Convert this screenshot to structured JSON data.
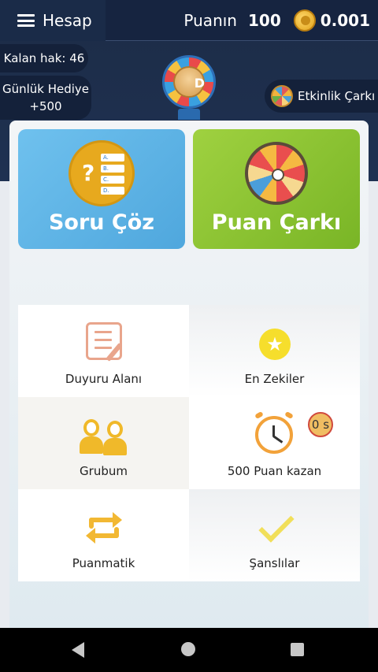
{
  "topbar": {
    "menu_label": "Hesap",
    "score_label": "Puanın",
    "score_value": "100",
    "coin_value": "0.001"
  },
  "side": {
    "remaining": "Kalan hak: 46",
    "gift_line1": "Günlük Hediye",
    "gift_line2": "+500",
    "event_wheel": "Etkinlik Çarkı"
  },
  "cards": {
    "quiz_title": "Soru Çöz",
    "wheel_title": "Puan Çarkı",
    "quiz_icon_letters": [
      "A.",
      "B.",
      "C.",
      "D."
    ]
  },
  "tiles": {
    "announcements": "Duyuru Alanı",
    "top_smart": "En Zekiler",
    "group": "Grubum",
    "earn_500": "500 Puan kazan",
    "timer": "0 s",
    "pointmatic": "Puanmatik",
    "lucky": "Şanslılar"
  },
  "colors": {
    "header": "#1c2c46",
    "quiz_card": "#5fb3e6",
    "wheel_card": "#8cc434"
  }
}
